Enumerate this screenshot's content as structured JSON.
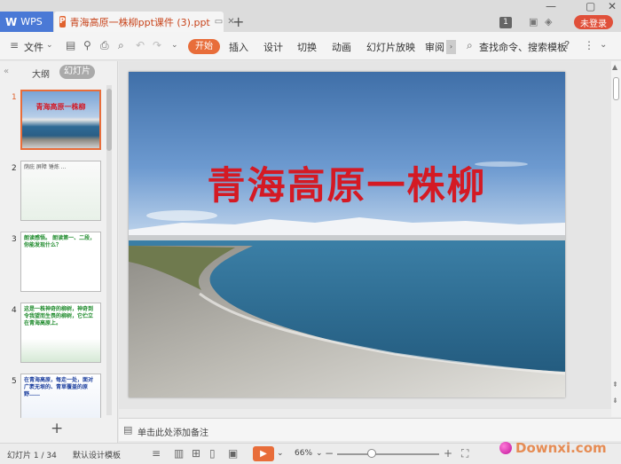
{
  "titlebar": {
    "app_tab": "WPS",
    "doc_tab_title": "青海高原一株柳ppt课件 (3).ppt",
    "page_count_badge": "1",
    "login_label": "未登录"
  },
  "ribbon": {
    "file_label": "文件",
    "tabs": [
      "开始",
      "插入",
      "设计",
      "切换",
      "动画",
      "幻灯片放映",
      "审阅"
    ],
    "search_placeholder": "查找命令、搜索模板"
  },
  "left_panel": {
    "outline_tab": "大纲",
    "slides_tab": "幻灯片",
    "thumbnails": [
      {
        "num": "1",
        "text": "青海高原一株柳"
      },
      {
        "num": "2",
        "text": "荫庇 屏障 锤炼 ..."
      },
      {
        "num": "3",
        "text": "朗读感悟。 朗读第一、二段，你能发现什么？"
      },
      {
        "num": "4",
        "text": "这是一株神奇的柳树，神奇到令我望而生畏的柳树，它伫立在青海高原上。"
      },
      {
        "num": "5",
        "text": "在青海高原，每走一处，面对广袤无垠的、青草覆盖的原野……"
      }
    ]
  },
  "slide": {
    "title": "青海高原一株柳"
  },
  "notes": {
    "placeholder": "单击此处添加备注"
  },
  "status": {
    "slide_counter": "幻灯片 1 / 34",
    "template": "默认设计模板",
    "zoom": "66%",
    "watermark": "Downxi.com"
  },
  "colors": {
    "accent": "#e86d3a",
    "title_red": "#d41a24",
    "wps_blue": "#4a79d6"
  }
}
